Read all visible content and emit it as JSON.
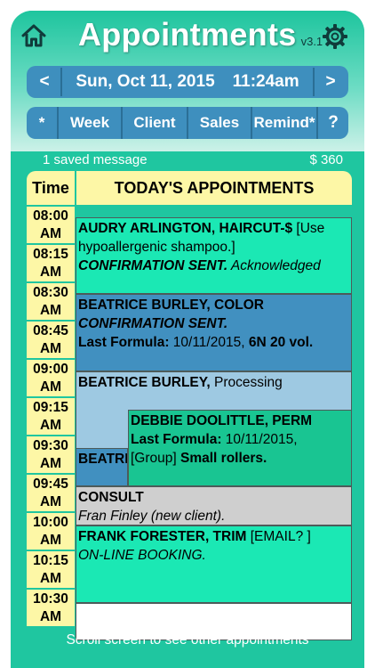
{
  "header": {
    "title": "Appointments",
    "version": "v3.1",
    "home_icon": "home-icon",
    "settings_icon": "gear-icon"
  },
  "datebar": {
    "prev_label": "<",
    "date": "Sun, Oct 11, 2015",
    "time": "11:24am",
    "next_label": ">"
  },
  "tabs": [
    {
      "label": "*"
    },
    {
      "label": "Week"
    },
    {
      "label": "Client"
    },
    {
      "label": "Sales"
    },
    {
      "label": "Remind*"
    },
    {
      "label": "?"
    }
  ],
  "status": {
    "messages": "1 saved message",
    "amount": "$ 360"
  },
  "schedule": {
    "time_header": "Time",
    "appointments_header": "TODAY'S APPOINTMENTS",
    "times": [
      {
        "time": "08:00",
        "period": "AM"
      },
      {
        "time": "08:15",
        "period": "AM"
      },
      {
        "time": "08:30",
        "period": "AM"
      },
      {
        "time": "08:45",
        "period": "AM"
      },
      {
        "time": "09:00",
        "period": "AM"
      },
      {
        "time": "09:15",
        "period": "AM"
      },
      {
        "time": "09:30",
        "period": "AM"
      },
      {
        "time": "09:45",
        "period": "AM"
      },
      {
        "time": "10:00",
        "period": "AM"
      },
      {
        "time": "10:15",
        "period": "AM"
      },
      {
        "time": "10:30",
        "period": "AM"
      }
    ],
    "appointments": {
      "audry": {
        "name": "AUDRY ARLINGTON, HAIRCUT-$",
        "note": " [Use hypoallergenic shampoo.]",
        "status": "CONFIRMATION SENT.",
        "status_extra": " Acknowledged"
      },
      "beatrice_color": {
        "name": "BEATRICE BURLEY, COLOR",
        "status": "CONFIRMATION SENT.",
        "formula_label": "Last Formula:",
        "formula_date": " 10/11/2015,",
        "formula_value": " 6N 20 vol."
      },
      "beatrice_processing": {
        "name": "BEATRICE BURLEY,",
        "service": " Processing",
        "truncated": "BEATRI"
      },
      "debbie": {
        "name": "DEBBIE DOOLITTLE, PERM",
        "formula_label": "Last Formula:",
        "formula_date": " 10/11/2015,",
        "group": " [Group]",
        "detail": " Small rollers."
      },
      "consult": {
        "name": "CONSULT",
        "client": "Fran Finley (new client)."
      },
      "frank": {
        "name": "FRANK FORESTER, TRIM",
        "note": " [EMAIL? ]",
        "status": "ON-LINE BOOKING."
      }
    }
  },
  "footer": {
    "hint": "Scroll screen to see other appointments"
  }
}
